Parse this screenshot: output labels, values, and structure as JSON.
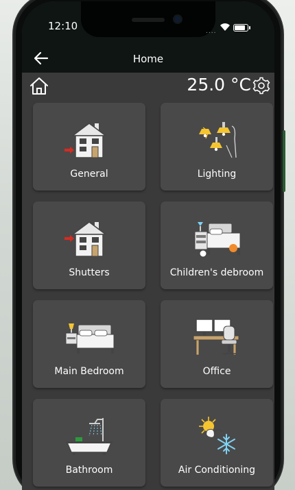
{
  "status_bar": {
    "time": "12:10",
    "signal_dots": "....",
    "battery_level": 0.85
  },
  "header": {
    "title": "Home"
  },
  "toolbar": {
    "temperature": "25.0 °C"
  },
  "rooms": [
    {
      "label": "General",
      "icon": "house-icon"
    },
    {
      "label": "Lighting",
      "icon": "lamps-icon"
    },
    {
      "label": "Shutters",
      "icon": "house-icon"
    },
    {
      "label": "Children's debroom",
      "icon": "kids-bed-icon"
    },
    {
      "label": "Main Bedroom",
      "icon": "bed-icon"
    },
    {
      "label": "Office",
      "icon": "desk-icon"
    },
    {
      "label": "Bathroom",
      "icon": "bathtub-icon"
    },
    {
      "label": "Air Conditioning",
      "icon": "sun-snowflake-icon"
    }
  ],
  "colors": {
    "navbar": "#0e1513",
    "screen": "#3b3a3a",
    "tile": "#4a4949",
    "accent_red": "#d62b20",
    "lamp_yellow": "#f4c531"
  }
}
